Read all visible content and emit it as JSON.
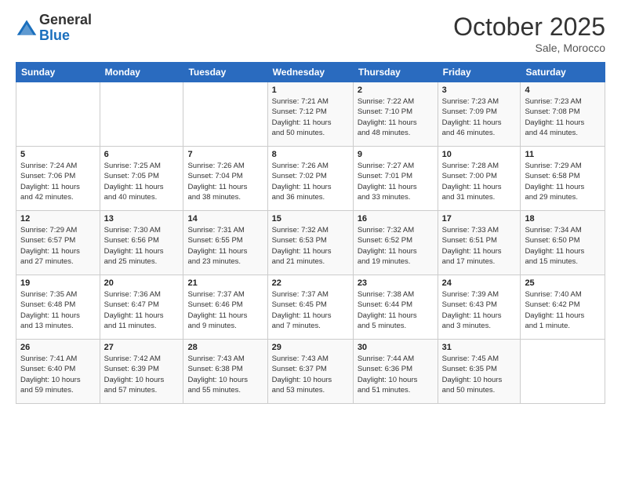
{
  "logo": {
    "general": "General",
    "blue": "Blue"
  },
  "header": {
    "month": "October 2025",
    "location": "Sale, Morocco"
  },
  "weekdays": [
    "Sunday",
    "Monday",
    "Tuesday",
    "Wednesday",
    "Thursday",
    "Friday",
    "Saturday"
  ],
  "weeks": [
    [
      {
        "day": "",
        "info": ""
      },
      {
        "day": "",
        "info": ""
      },
      {
        "day": "",
        "info": ""
      },
      {
        "day": "1",
        "info": "Sunrise: 7:21 AM\nSunset: 7:12 PM\nDaylight: 11 hours\nand 50 minutes."
      },
      {
        "day": "2",
        "info": "Sunrise: 7:22 AM\nSunset: 7:10 PM\nDaylight: 11 hours\nand 48 minutes."
      },
      {
        "day": "3",
        "info": "Sunrise: 7:23 AM\nSunset: 7:09 PM\nDaylight: 11 hours\nand 46 minutes."
      },
      {
        "day": "4",
        "info": "Sunrise: 7:23 AM\nSunset: 7:08 PM\nDaylight: 11 hours\nand 44 minutes."
      }
    ],
    [
      {
        "day": "5",
        "info": "Sunrise: 7:24 AM\nSunset: 7:06 PM\nDaylight: 11 hours\nand 42 minutes."
      },
      {
        "day": "6",
        "info": "Sunrise: 7:25 AM\nSunset: 7:05 PM\nDaylight: 11 hours\nand 40 minutes."
      },
      {
        "day": "7",
        "info": "Sunrise: 7:26 AM\nSunset: 7:04 PM\nDaylight: 11 hours\nand 38 minutes."
      },
      {
        "day": "8",
        "info": "Sunrise: 7:26 AM\nSunset: 7:02 PM\nDaylight: 11 hours\nand 36 minutes."
      },
      {
        "day": "9",
        "info": "Sunrise: 7:27 AM\nSunset: 7:01 PM\nDaylight: 11 hours\nand 33 minutes."
      },
      {
        "day": "10",
        "info": "Sunrise: 7:28 AM\nSunset: 7:00 PM\nDaylight: 11 hours\nand 31 minutes."
      },
      {
        "day": "11",
        "info": "Sunrise: 7:29 AM\nSunset: 6:58 PM\nDaylight: 11 hours\nand 29 minutes."
      }
    ],
    [
      {
        "day": "12",
        "info": "Sunrise: 7:29 AM\nSunset: 6:57 PM\nDaylight: 11 hours\nand 27 minutes."
      },
      {
        "day": "13",
        "info": "Sunrise: 7:30 AM\nSunset: 6:56 PM\nDaylight: 11 hours\nand 25 minutes."
      },
      {
        "day": "14",
        "info": "Sunrise: 7:31 AM\nSunset: 6:55 PM\nDaylight: 11 hours\nand 23 minutes."
      },
      {
        "day": "15",
        "info": "Sunrise: 7:32 AM\nSunset: 6:53 PM\nDaylight: 11 hours\nand 21 minutes."
      },
      {
        "day": "16",
        "info": "Sunrise: 7:32 AM\nSunset: 6:52 PM\nDaylight: 11 hours\nand 19 minutes."
      },
      {
        "day": "17",
        "info": "Sunrise: 7:33 AM\nSunset: 6:51 PM\nDaylight: 11 hours\nand 17 minutes."
      },
      {
        "day": "18",
        "info": "Sunrise: 7:34 AM\nSunset: 6:50 PM\nDaylight: 11 hours\nand 15 minutes."
      }
    ],
    [
      {
        "day": "19",
        "info": "Sunrise: 7:35 AM\nSunset: 6:48 PM\nDaylight: 11 hours\nand 13 minutes."
      },
      {
        "day": "20",
        "info": "Sunrise: 7:36 AM\nSunset: 6:47 PM\nDaylight: 11 hours\nand 11 minutes."
      },
      {
        "day": "21",
        "info": "Sunrise: 7:37 AM\nSunset: 6:46 PM\nDaylight: 11 hours\nand 9 minutes."
      },
      {
        "day": "22",
        "info": "Sunrise: 7:37 AM\nSunset: 6:45 PM\nDaylight: 11 hours\nand 7 minutes."
      },
      {
        "day": "23",
        "info": "Sunrise: 7:38 AM\nSunset: 6:44 PM\nDaylight: 11 hours\nand 5 minutes."
      },
      {
        "day": "24",
        "info": "Sunrise: 7:39 AM\nSunset: 6:43 PM\nDaylight: 11 hours\nand 3 minutes."
      },
      {
        "day": "25",
        "info": "Sunrise: 7:40 AM\nSunset: 6:42 PM\nDaylight: 11 hours\nand 1 minute."
      }
    ],
    [
      {
        "day": "26",
        "info": "Sunrise: 7:41 AM\nSunset: 6:40 PM\nDaylight: 10 hours\nand 59 minutes."
      },
      {
        "day": "27",
        "info": "Sunrise: 7:42 AM\nSunset: 6:39 PM\nDaylight: 10 hours\nand 57 minutes."
      },
      {
        "day": "28",
        "info": "Sunrise: 7:43 AM\nSunset: 6:38 PM\nDaylight: 10 hours\nand 55 minutes."
      },
      {
        "day": "29",
        "info": "Sunrise: 7:43 AM\nSunset: 6:37 PM\nDaylight: 10 hours\nand 53 minutes."
      },
      {
        "day": "30",
        "info": "Sunrise: 7:44 AM\nSunset: 6:36 PM\nDaylight: 10 hours\nand 51 minutes."
      },
      {
        "day": "31",
        "info": "Sunrise: 7:45 AM\nSunset: 6:35 PM\nDaylight: 10 hours\nand 50 minutes."
      },
      {
        "day": "",
        "info": ""
      }
    ]
  ]
}
